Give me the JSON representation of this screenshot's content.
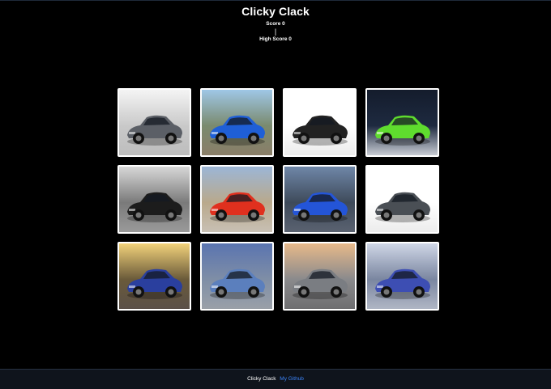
{
  "app": {
    "title": "Clicky Clack",
    "score_label": "Score 0",
    "separator": "|",
    "high_score_label": "High Score 0"
  },
  "grid": {
    "cards": [
      {
        "name": "silver-sports-car",
        "bg": "light-studio",
        "car_color": "#5b5f66"
      },
      {
        "name": "blue-supra",
        "bg": "sky-road",
        "car_color": "#1f5fd6"
      },
      {
        "name": "black-mustang",
        "bg": "white",
        "car_color": "#222222"
      },
      {
        "name": "green-porsche",
        "bg": "dark-showroom",
        "car_color": "#5fdc2e"
      },
      {
        "name": "black-gtr",
        "bg": "urban",
        "car_color": "#1c1c1c"
      },
      {
        "name": "red-corvette",
        "bg": "desert",
        "car_color": "#e0301e"
      },
      {
        "name": "blue-bmw",
        "bg": "cloudy",
        "car_color": "#2455d8"
      },
      {
        "name": "gray-audi-r8",
        "bg": "white",
        "car_color": "#4a4f55"
      },
      {
        "name": "blue-skyline",
        "bg": "sunset",
        "car_color": "#2a3f9e"
      },
      {
        "name": "blue-convertible",
        "bg": "mountains",
        "car_color": "#5b7fbd"
      },
      {
        "name": "silver-supercar",
        "bg": "dusk",
        "car_color": "#7a7d82"
      },
      {
        "name": "blue-mclaren",
        "bg": "garage",
        "car_color": "#3d4eb3"
      }
    ]
  },
  "footer": {
    "label": "Clicky Clack",
    "link_text": "My Github"
  }
}
